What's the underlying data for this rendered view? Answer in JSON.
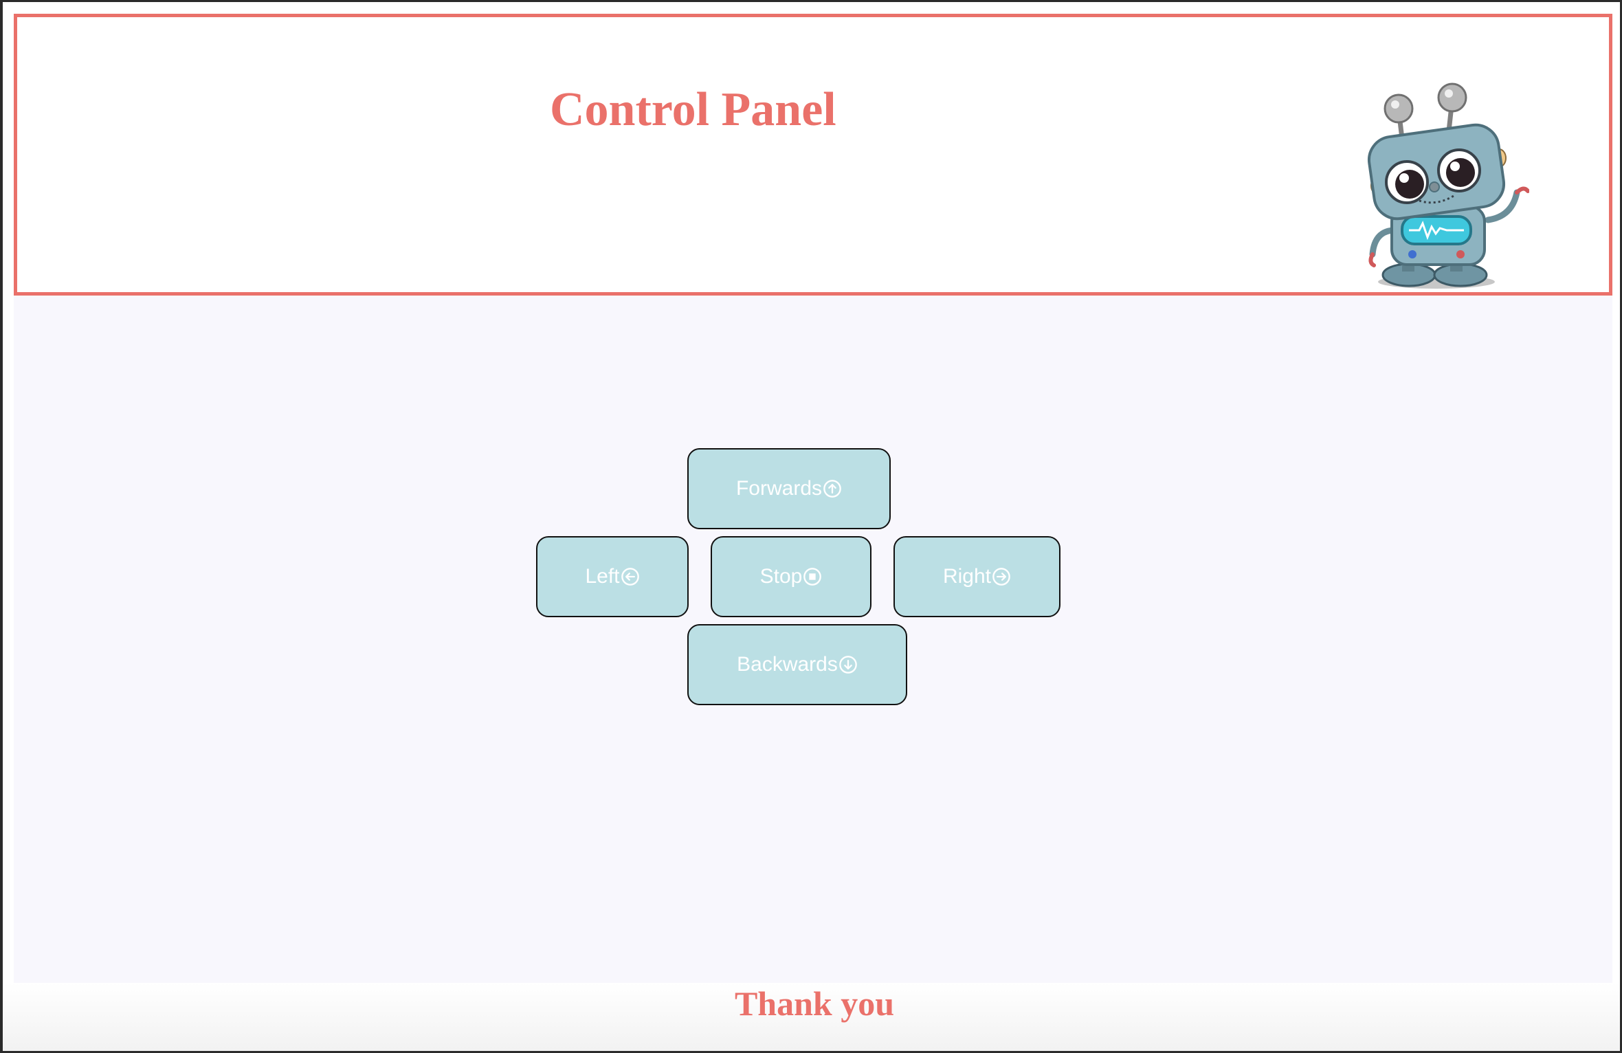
{
  "header": {
    "title": "Control Panel",
    "mascot_icon": "robot-icon"
  },
  "controls": {
    "forward": {
      "label": "Forwards",
      "icon": "arrow-up-circle-icon"
    },
    "left": {
      "label": "Left",
      "icon": "arrow-left-circle-icon"
    },
    "stop": {
      "label": "Stop",
      "icon": "stop-circle-icon"
    },
    "right": {
      "label": "Right",
      "icon": "arrow-right-circle-icon"
    },
    "backward": {
      "label": "Backwards",
      "icon": "arrow-down-circle-icon"
    }
  },
  "footer": {
    "text": "Thank you"
  },
  "colors": {
    "accent": "#ea716a",
    "button_bg": "#bbdfe4",
    "content_bg": "#f8f7fd"
  }
}
